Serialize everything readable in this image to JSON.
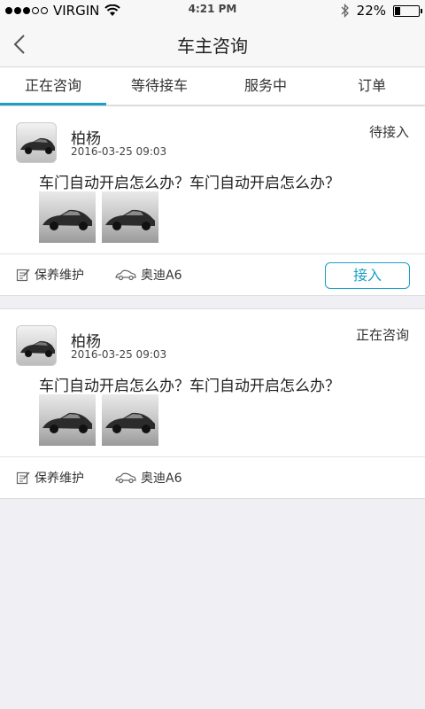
{
  "status_bar": {
    "carrier": "VIRGIN",
    "time": "4:21 PM",
    "battery": "22%",
    "battery_level": 0.22
  },
  "nav": {
    "title": "车主咨询"
  },
  "tabs": [
    {
      "label": "正在咨询",
      "active": true
    },
    {
      "label": "等待接车",
      "active": false
    },
    {
      "label": "服务中",
      "active": false
    },
    {
      "label": "订单",
      "active": false
    }
  ],
  "consultations": [
    {
      "name": "柏杨",
      "time": "2016-03-25 09:03",
      "status": "待接入",
      "question": "车门自动开启怎么办？车门自动开启怎么办？",
      "service": "保养维护",
      "car": "奥迪A6",
      "action": "接入"
    },
    {
      "name": "柏杨",
      "time": "2016-03-25 09:03",
      "status": "正在咨询",
      "question": "车门自动开启怎么办？车门自动开启怎么办？",
      "service": "保养维护",
      "car": "奥迪A6"
    }
  ],
  "colors": {
    "accent": "#1aa0c8",
    "background": "#efeff4"
  }
}
